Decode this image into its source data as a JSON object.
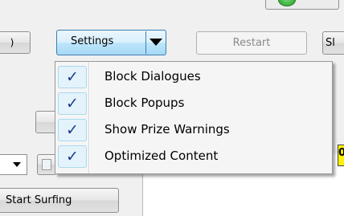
{
  "toolbar": {
    "left_partial_label": ")",
    "settings_label": "Settings",
    "restart_label": "Restart",
    "right_partial_label": "Sl"
  },
  "settings_menu": {
    "items": [
      {
        "label": "Block Dialogues",
        "checked": true
      },
      {
        "label": "Block Popups",
        "checked": true
      },
      {
        "label": "Show Prize Warnings",
        "checked": true
      },
      {
        "label": "Optimized Content",
        "checked": true
      }
    ],
    "check_glyph": "✓"
  },
  "bottom": {
    "start_label": "Start Surfing",
    "right_indicator_glyph": "0"
  },
  "colors": {
    "check": "#1c3b8c",
    "settings_highlight": "#a7d9f5",
    "status_dot": "#1f9a1f",
    "indicator_yellow": "#fff200"
  }
}
